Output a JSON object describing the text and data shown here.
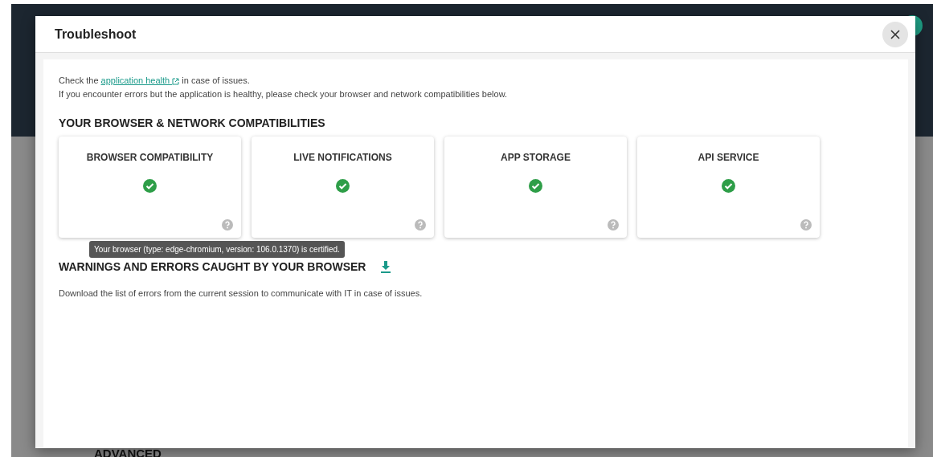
{
  "background": {
    "section_label": "ADVANCED"
  },
  "dialog": {
    "title": "Troubleshoot",
    "intro": {
      "before": "Check the ",
      "link": "application health",
      "after": " in case of issues.",
      "line2": "If you encounter errors but the application is healthy, please check your browser and network compatibilities below."
    },
    "compat_heading": "YOUR BROWSER & NETWORK COMPATIBILITIES",
    "checks": [
      {
        "label": "BROWSER COMPATIBILITY",
        "passed": true
      },
      {
        "label": "LIVE NOTIFICATIONS",
        "passed": true
      },
      {
        "label": "APP STORAGE",
        "passed": true
      },
      {
        "label": "API SERVICE",
        "passed": true
      }
    ],
    "tooltip": "Your browser (type: edge-chromium, version: 106.0.1370) is certified.",
    "errors_heading": "WARNINGS AND ERRORS CAUGHT BY YOUR BROWSER",
    "errors_text": "Download the list of errors from the current session to communicate with IT in case of issues."
  }
}
